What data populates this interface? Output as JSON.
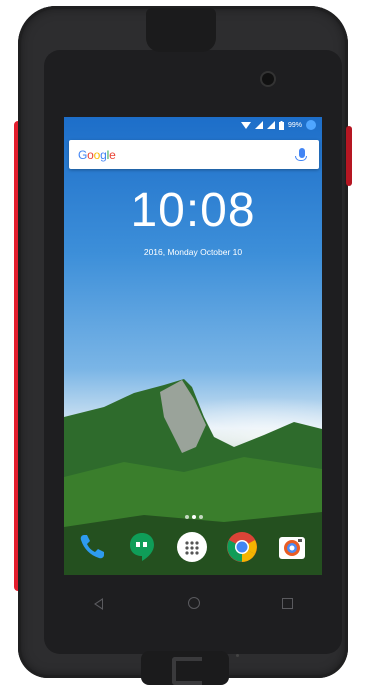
{
  "statusbar": {
    "battery_text": "99%",
    "icons": [
      "wifi-icon",
      "signal-icon",
      "signal-icon",
      "battery-icon",
      "account-icon"
    ]
  },
  "search": {
    "logo_letters": [
      "G",
      "o",
      "o",
      "g",
      "l",
      "e"
    ],
    "logo_colors": [
      "#4285f4",
      "#ea4335",
      "#fbbc05",
      "#4285f4",
      "#34a853",
      "#ea4335"
    ]
  },
  "lockscreen": {
    "time": "10:08",
    "date": "2016, Monday October 10"
  },
  "dock": {
    "apps": [
      {
        "name": "phone",
        "icon": "phone-icon"
      },
      {
        "name": "hangouts",
        "icon": "hangouts-icon"
      },
      {
        "name": "app-drawer",
        "icon": "apps-icon"
      },
      {
        "name": "chrome",
        "icon": "chrome-icon"
      },
      {
        "name": "camera",
        "icon": "camera-icon"
      }
    ]
  },
  "navbar": {
    "buttons": [
      "back-icon",
      "home-icon",
      "recents-icon"
    ]
  },
  "colors": {
    "accent_red": "#e31d2d",
    "body": "#2d2d2f"
  }
}
